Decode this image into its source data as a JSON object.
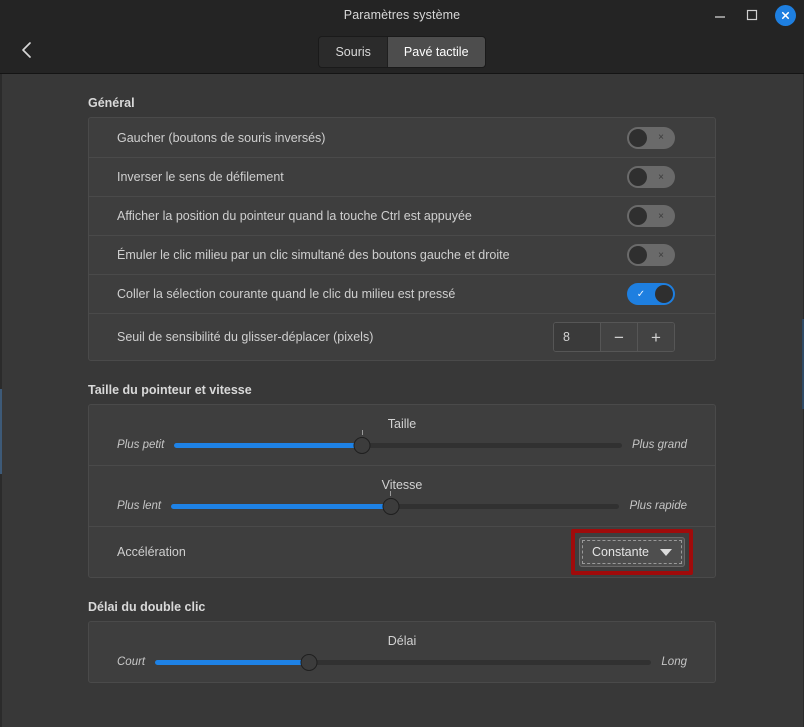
{
  "window": {
    "title": "Paramètres système",
    "controls": {
      "minimize": "minimize-icon",
      "maximize": "maximize-icon",
      "close": "close-icon"
    }
  },
  "header": {
    "back_icon": "chevron-left-icon",
    "tabs": [
      {
        "label": "Souris",
        "active": false
      },
      {
        "label": "Pavé tactile",
        "active": true
      }
    ]
  },
  "sections": [
    {
      "title": "Général",
      "rows": [
        {
          "label": "Gaucher (boutons de souris inversés)",
          "control": "switch",
          "state": "off",
          "off_glyph": "×"
        },
        {
          "label": "Inverser le sens de défilement",
          "control": "switch",
          "state": "off",
          "off_glyph": "×"
        },
        {
          "label": "Afficher la position du pointeur quand la touche Ctrl est appuyée",
          "control": "switch",
          "state": "off",
          "off_glyph": "×"
        },
        {
          "label": "Émuler le clic milieu par un clic simultané des boutons gauche et droite",
          "control": "switch",
          "state": "off",
          "off_glyph": "×"
        },
        {
          "label": "Coller la sélection courante quand le clic du milieu est pressé",
          "control": "switch",
          "state": "on",
          "on_glyph": "✓"
        },
        {
          "label": "Seuil de sensibilité du glisser-déplacer (pixels)",
          "control": "spin",
          "value": "8",
          "minus": "−",
          "plus": "+"
        }
      ]
    },
    {
      "title": "Taille du pointeur et vitesse",
      "sliders": [
        {
          "caption": "Taille",
          "left": "Plus petit",
          "right": "Plus grand",
          "percent": 42
        },
        {
          "caption": "Vitesse",
          "left": "Plus lent",
          "right": "Plus rapide",
          "percent": 49
        }
      ],
      "dropdown_row": {
        "label": "Accélération",
        "value": "Constante",
        "caret_icon": "chevron-down-icon",
        "highlight_color": "#a00b0b"
      }
    },
    {
      "title": "Délai du double clic",
      "sliders": [
        {
          "caption": "Délai",
          "left": "Court",
          "right": "Long",
          "percent": 31
        }
      ]
    }
  ],
  "colors": {
    "accent": "#1e82e6",
    "close_button": "#1e7fe0",
    "window_bg": "#383838",
    "card_bg": "#3e3e3e",
    "titlebar_bg": "#242424",
    "highlight": "#a00b0b"
  }
}
